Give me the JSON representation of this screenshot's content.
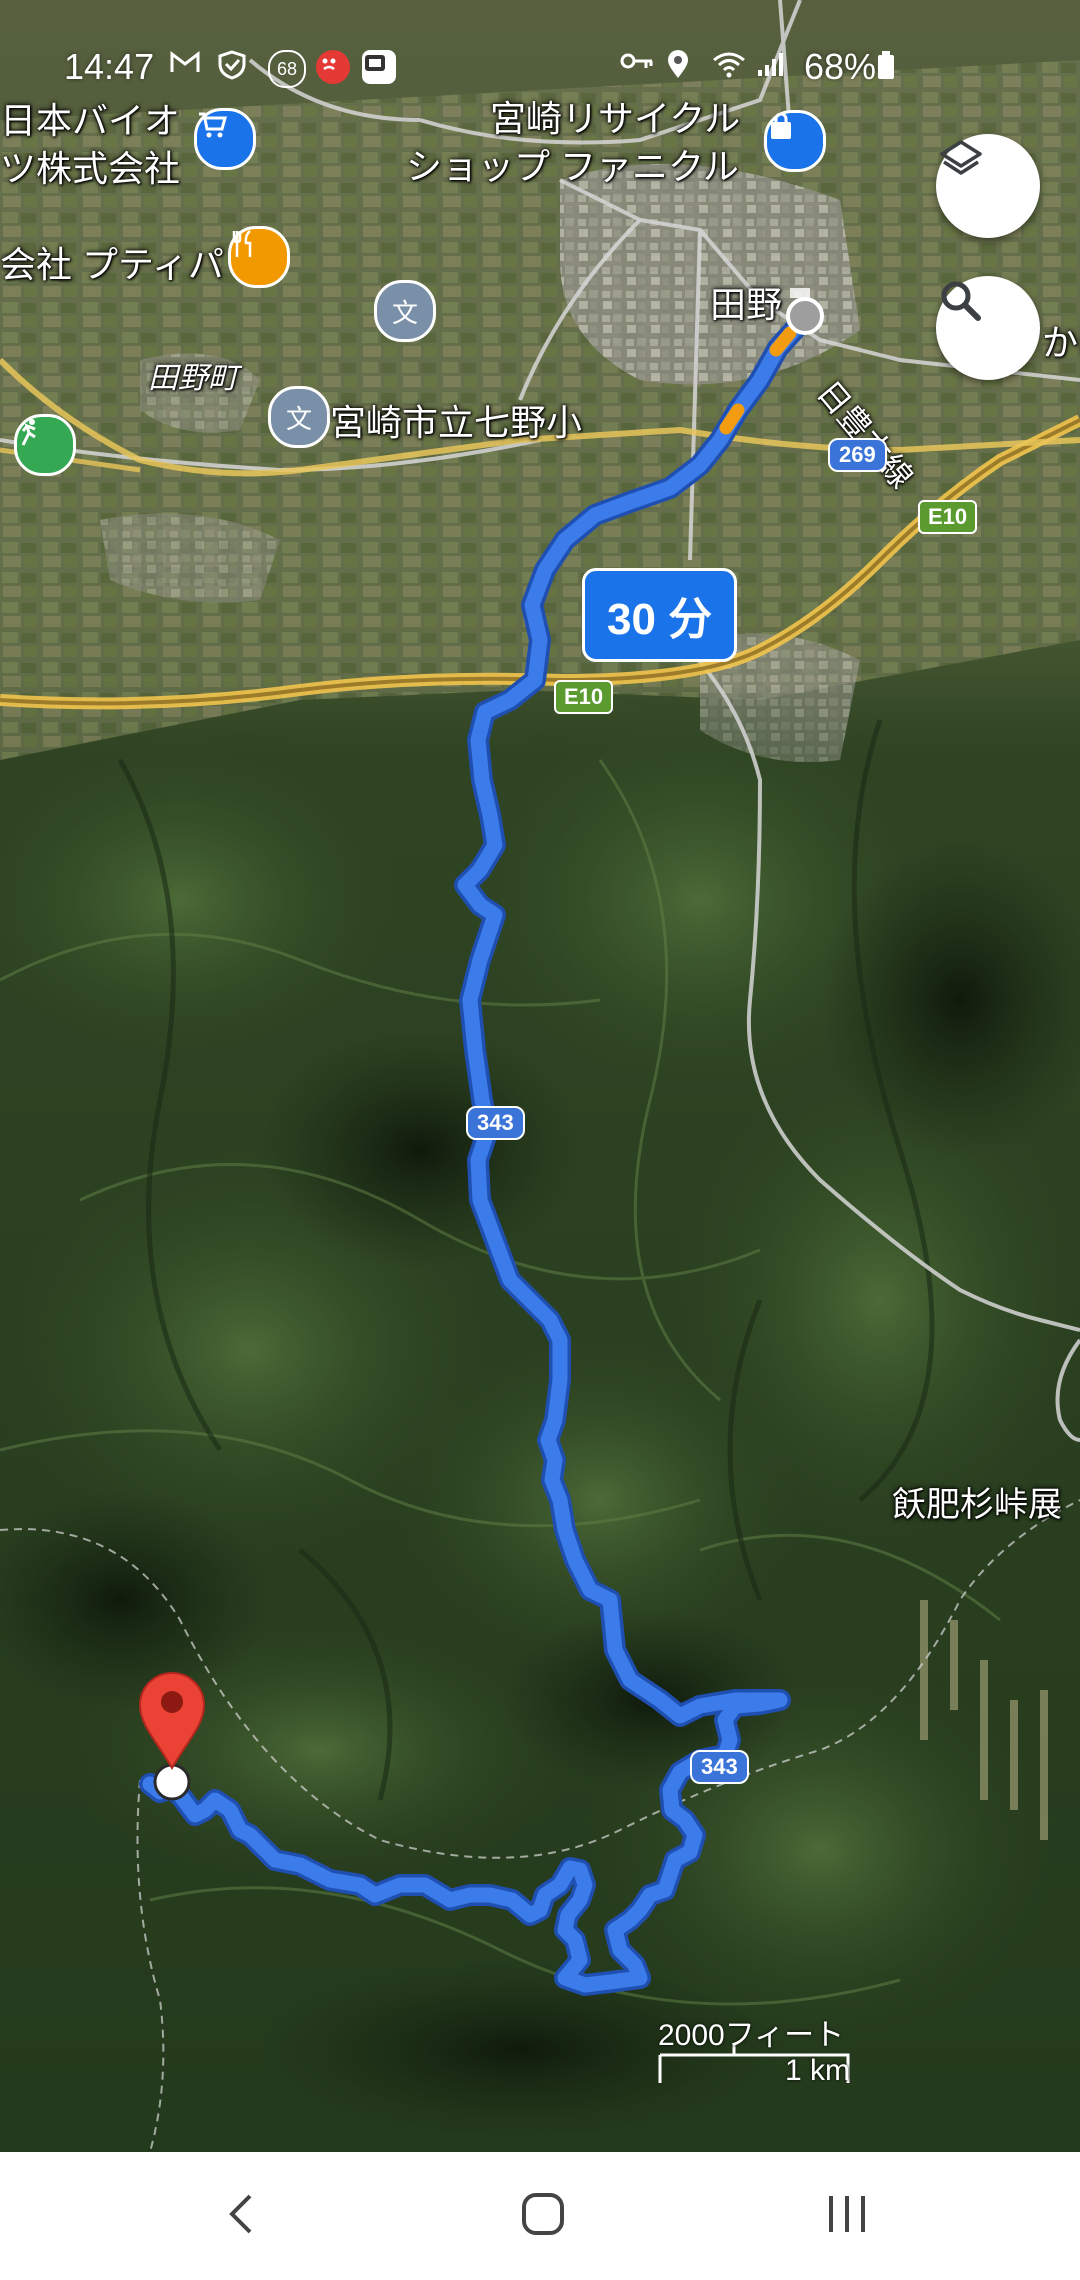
{
  "status_bar": {
    "time": "14:47",
    "notification_icons": [
      "gmail-icon",
      "shield-icon",
      "badge-68-icon",
      "angry-face-icon",
      "app-icon"
    ],
    "badge_count": "68",
    "right_icons": [
      "key-icon",
      "location-icon",
      "wifi-icon",
      "signal-icon",
      "battery-icon"
    ],
    "battery": "68%"
  },
  "map": {
    "labels": {
      "nihon_bio": "日本バイオ",
      "nihon_bio_2": "ツ株式会社",
      "miyazaki_recycle": "宮崎リサイクル",
      "miyazaki_recycle_2": "ショップ ファニクル",
      "kaisha_petit": "会社 プティパ",
      "tano_town": "田野町",
      "nanano_school": "宮崎市立七野小",
      "tano": "田野",
      "nippo_line": "日豊本線",
      "kani": "かに",
      "obi_sugi_pass": "飫肥杉峠展"
    },
    "route_shields": {
      "r269": "269",
      "r343_a": "343",
      "r343_b": "343"
    },
    "expressway": {
      "e10_a": "E10",
      "e10_b": "E10"
    },
    "eta": "30 分",
    "scale": {
      "feet": "2000フィート",
      "km": "1 km"
    },
    "colors": {
      "route": "#3b7bea",
      "route_outline": "#1f4fb0",
      "pin": "#ea4335"
    }
  },
  "buttons": {
    "layers": "layers-icon",
    "search": "search-icon"
  },
  "navbar": {
    "back": "back-icon",
    "home": "home-icon",
    "recents": "recents-icon"
  }
}
